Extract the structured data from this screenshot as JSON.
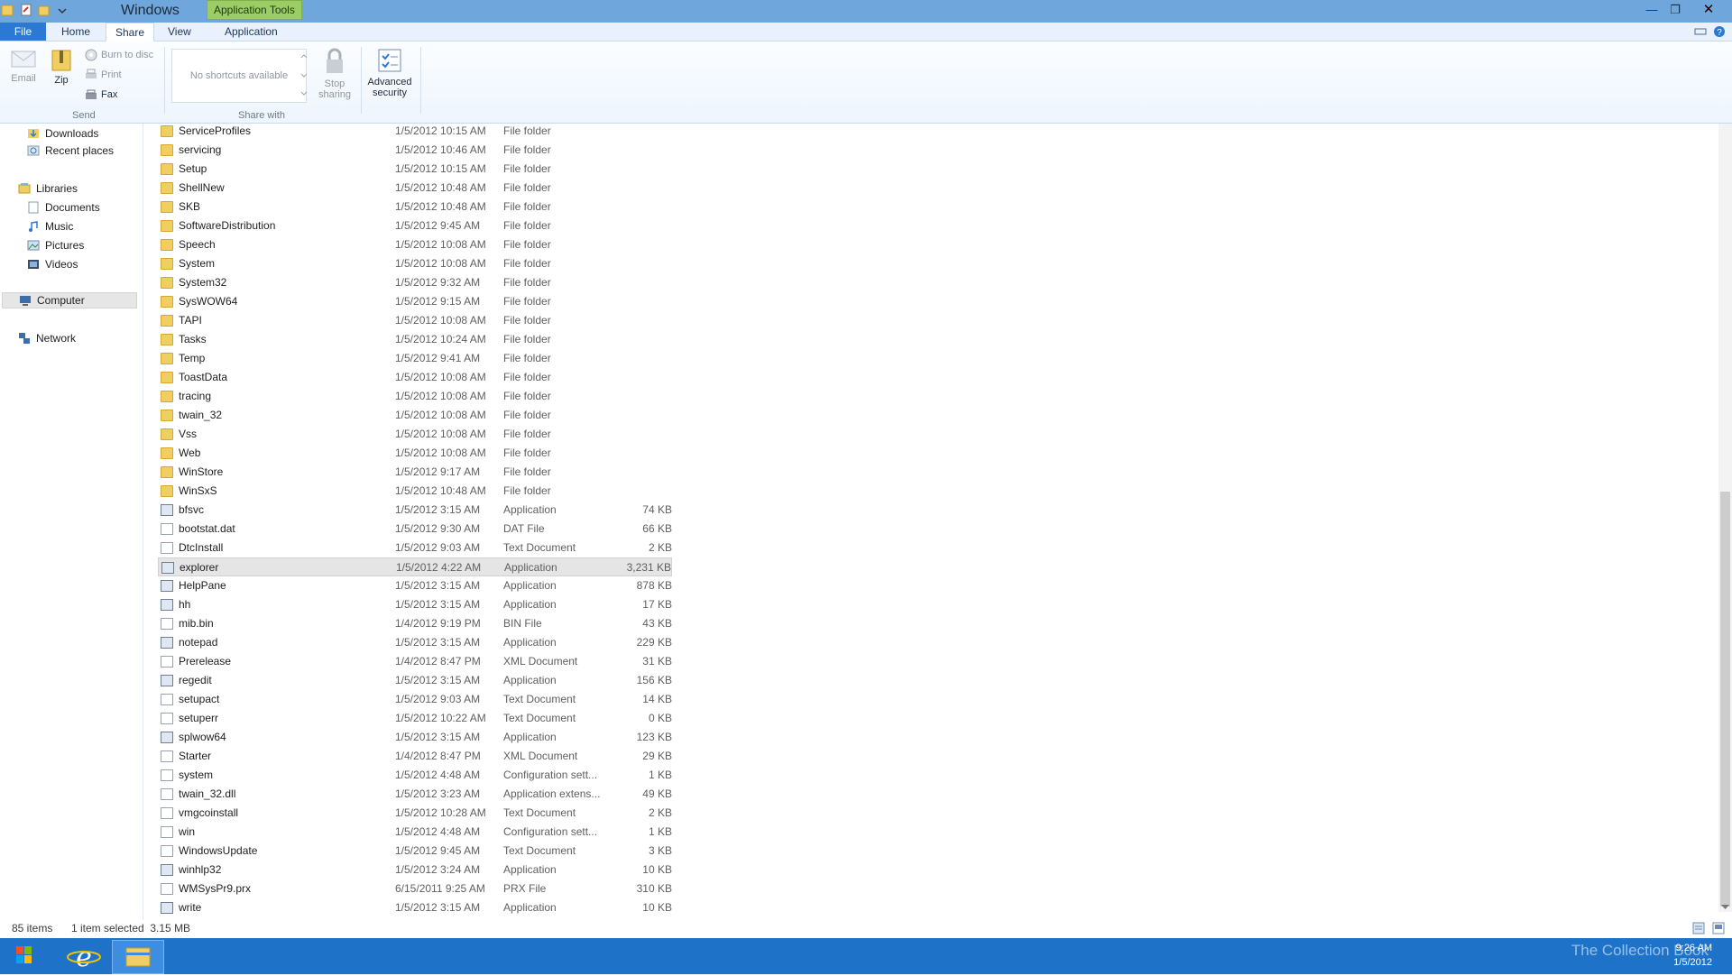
{
  "window": {
    "title": "Windows",
    "context_tab": "Application Tools",
    "controls": {
      "minimize": "—",
      "maximize": "❐",
      "close": "✕"
    }
  },
  "ribbon": {
    "tabs": [
      "File",
      "Home",
      "Share",
      "View",
      "Application"
    ],
    "active_tab": "Share",
    "send_group": {
      "label": "Send",
      "email": "Email",
      "zip": "Zip",
      "burn": "Burn to disc",
      "print": "Print",
      "fax": "Fax"
    },
    "share_with_group": {
      "label": "Share with",
      "shortcuts_placeholder": "No shortcuts available",
      "stop_sharing_line1": "Stop",
      "stop_sharing_line2": "sharing"
    },
    "advanced_security_line1": "Advanced",
    "advanced_security_line2": "security"
  },
  "nav_pane": {
    "items": [
      {
        "label": "Downloads",
        "icon": "downloads-icon"
      },
      {
        "label": "Recent places",
        "icon": "recent-places-icon"
      },
      {
        "label": "Libraries",
        "icon": "libraries-icon"
      },
      {
        "label": "Documents",
        "icon": "documents-icon"
      },
      {
        "label": "Music",
        "icon": "music-icon"
      },
      {
        "label": "Pictures",
        "icon": "pictures-icon"
      },
      {
        "label": "Videos",
        "icon": "videos-icon"
      },
      {
        "label": "Computer",
        "icon": "computer-icon"
      },
      {
        "label": "Network",
        "icon": "network-icon"
      }
    ]
  },
  "files": [
    {
      "name": "ServiceProfiles",
      "date": "1/5/2012 10:15 AM",
      "type": "File folder",
      "size": "",
      "icon": "folder"
    },
    {
      "name": "servicing",
      "date": "1/5/2012 10:46 AM",
      "type": "File folder",
      "size": "",
      "icon": "folder"
    },
    {
      "name": "Setup",
      "date": "1/5/2012 10:15 AM",
      "type": "File folder",
      "size": "",
      "icon": "folder"
    },
    {
      "name": "ShellNew",
      "date": "1/5/2012 10:48 AM",
      "type": "File folder",
      "size": "",
      "icon": "folder"
    },
    {
      "name": "SKB",
      "date": "1/5/2012 10:48 AM",
      "type": "File folder",
      "size": "",
      "icon": "folder"
    },
    {
      "name": "SoftwareDistribution",
      "date": "1/5/2012 9:45 AM",
      "type": "File folder",
      "size": "",
      "icon": "folder"
    },
    {
      "name": "Speech",
      "date": "1/5/2012 10:08 AM",
      "type": "File folder",
      "size": "",
      "icon": "folder"
    },
    {
      "name": "System",
      "date": "1/5/2012 10:08 AM",
      "type": "File folder",
      "size": "",
      "icon": "folder"
    },
    {
      "name": "System32",
      "date": "1/5/2012 9:32 AM",
      "type": "File folder",
      "size": "",
      "icon": "folder"
    },
    {
      "name": "SysWOW64",
      "date": "1/5/2012 9:15 AM",
      "type": "File folder",
      "size": "",
      "icon": "folder"
    },
    {
      "name": "TAPI",
      "date": "1/5/2012 10:08 AM",
      "type": "File folder",
      "size": "",
      "icon": "folder"
    },
    {
      "name": "Tasks",
      "date": "1/5/2012 10:24 AM",
      "type": "File folder",
      "size": "",
      "icon": "folder"
    },
    {
      "name": "Temp",
      "date": "1/5/2012 9:41 AM",
      "type": "File folder",
      "size": "",
      "icon": "folder"
    },
    {
      "name": "ToastData",
      "date": "1/5/2012 10:08 AM",
      "type": "File folder",
      "size": "",
      "icon": "folder"
    },
    {
      "name": "tracing",
      "date": "1/5/2012 10:08 AM",
      "type": "File folder",
      "size": "",
      "icon": "folder"
    },
    {
      "name": "twain_32",
      "date": "1/5/2012 10:08 AM",
      "type": "File folder",
      "size": "",
      "icon": "folder"
    },
    {
      "name": "Vss",
      "date": "1/5/2012 10:08 AM",
      "type": "File folder",
      "size": "",
      "icon": "folder"
    },
    {
      "name": "Web",
      "date": "1/5/2012 10:08 AM",
      "type": "File folder",
      "size": "",
      "icon": "folder"
    },
    {
      "name": "WinStore",
      "date": "1/5/2012 9:17 AM",
      "type": "File folder",
      "size": "",
      "icon": "folder"
    },
    {
      "name": "WinSxS",
      "date": "1/5/2012 10:48 AM",
      "type": "File folder",
      "size": "",
      "icon": "folder"
    },
    {
      "name": "bfsvc",
      "date": "1/5/2012 3:15 AM",
      "type": "Application",
      "size": "74 KB",
      "icon": "app"
    },
    {
      "name": "bootstat.dat",
      "date": "1/5/2012 9:30 AM",
      "type": "DAT File",
      "size": "66 KB",
      "icon": "doc"
    },
    {
      "name": "DtcInstall",
      "date": "1/5/2012 9:03 AM",
      "type": "Text Document",
      "size": "2 KB",
      "icon": "doc"
    },
    {
      "name": "explorer",
      "date": "1/5/2012 4:22 AM",
      "type": "Application",
      "size": "3,231 KB",
      "icon": "app",
      "selected": true
    },
    {
      "name": "HelpPane",
      "date": "1/5/2012 3:15 AM",
      "type": "Application",
      "size": "878 KB",
      "icon": "app"
    },
    {
      "name": "hh",
      "date": "1/5/2012 3:15 AM",
      "type": "Application",
      "size": "17 KB",
      "icon": "app"
    },
    {
      "name": "mib.bin",
      "date": "1/4/2012 9:19 PM",
      "type": "BIN File",
      "size": "43 KB",
      "icon": "doc"
    },
    {
      "name": "notepad",
      "date": "1/5/2012 3:15 AM",
      "type": "Application",
      "size": "229 KB",
      "icon": "app"
    },
    {
      "name": "Prerelease",
      "date": "1/4/2012 8:47 PM",
      "type": "XML Document",
      "size": "31 KB",
      "icon": "doc"
    },
    {
      "name": "regedit",
      "date": "1/5/2012 3:15 AM",
      "type": "Application",
      "size": "156 KB",
      "icon": "app"
    },
    {
      "name": "setupact",
      "date": "1/5/2012 9:03 AM",
      "type": "Text Document",
      "size": "14 KB",
      "icon": "doc"
    },
    {
      "name": "setuperr",
      "date": "1/5/2012 10:22 AM",
      "type": "Text Document",
      "size": "0 KB",
      "icon": "doc"
    },
    {
      "name": "splwow64",
      "date": "1/5/2012 3:15 AM",
      "type": "Application",
      "size": "123 KB",
      "icon": "app"
    },
    {
      "name": "Starter",
      "date": "1/4/2012 8:47 PM",
      "type": "XML Document",
      "size": "29 KB",
      "icon": "doc"
    },
    {
      "name": "system",
      "date": "1/5/2012 4:48 AM",
      "type": "Configuration sett...",
      "size": "1 KB",
      "icon": "doc"
    },
    {
      "name": "twain_32.dll",
      "date": "1/5/2012 3:23 AM",
      "type": "Application extens...",
      "size": "49 KB",
      "icon": "doc"
    },
    {
      "name": "vmgcoinstall",
      "date": "1/5/2012 10:28 AM",
      "type": "Text Document",
      "size": "2 KB",
      "icon": "doc"
    },
    {
      "name": "win",
      "date": "1/5/2012 4:48 AM",
      "type": "Configuration sett...",
      "size": "1 KB",
      "icon": "doc"
    },
    {
      "name": "WindowsUpdate",
      "date": "1/5/2012 9:45 AM",
      "type": "Text Document",
      "size": "3 KB",
      "icon": "doc"
    },
    {
      "name": "winhlp32",
      "date": "1/5/2012 3:24 AM",
      "type": "Application",
      "size": "10 KB",
      "icon": "app"
    },
    {
      "name": "WMSysPr9.prx",
      "date": "6/15/2011 9:25 AM",
      "type": "PRX File",
      "size": "310 KB",
      "icon": "doc"
    },
    {
      "name": "write",
      "date": "1/5/2012 3:15 AM",
      "type": "Application",
      "size": "10 KB",
      "icon": "app"
    }
  ],
  "status_bar": {
    "item_count": "85 items",
    "selection": "1 item selected  3.15 MB"
  },
  "taskbar": {
    "watermark": "The Collection Book",
    "time": "9:26 AM",
    "date": "1/5/2012"
  },
  "colors": {
    "titlebar": "#6fa7dc",
    "file_tab": "#2b79d3",
    "context_tab": "#9ccc65",
    "taskbar": "#1e73c8"
  }
}
